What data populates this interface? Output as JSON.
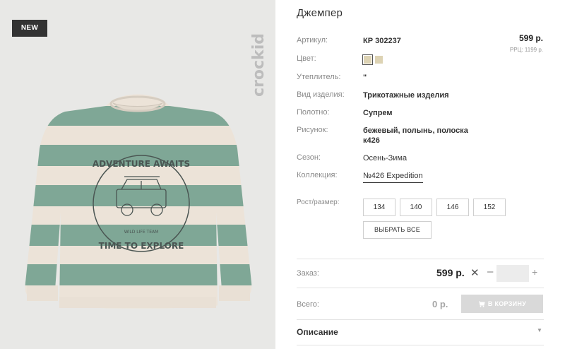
{
  "badge": "NEW",
  "brand": "crockid",
  "print": {
    "top_text": "ADVENTURE AWAITS",
    "bottom_text": "TIME TO EXPLORE",
    "small_text": "WILD LIFE TEAM"
  },
  "product": {
    "title": "Джемпер",
    "price": "599 р.",
    "rrp": "РРЦ: 1199 р."
  },
  "attributes": [
    {
      "label": "Артикул:",
      "value": "КР 302237"
    },
    {
      "label": "Цвет:",
      "value": ""
    },
    {
      "label": "Утеплитель:",
      "value": "\""
    },
    {
      "label": "Вид изделия:",
      "value": "Трикотажные изделия"
    },
    {
      "label": "Полотно:",
      "value": "Супрем"
    },
    {
      "label": "Рисунок:",
      "value": "бежевый, полынь, полоска",
      "value2": "к426"
    },
    {
      "label": "Сезон:",
      "value": "Осень-Зима"
    },
    {
      "label": "Коллекция:",
      "value": "№426 Expedition"
    }
  ],
  "colors": [
    "#ddd3b4",
    "#ddd3b4"
  ],
  "size": {
    "label": "Рост/размер:",
    "options": [
      "134",
      "140",
      "146",
      "152"
    ],
    "select_all": "ВЫБРАТЬ ВСЕ"
  },
  "order": {
    "label": "Заказ:",
    "price": "599 р.",
    "times": "✕",
    "minus": "–",
    "quantity": "",
    "plus": "+"
  },
  "total": {
    "label": "Всего:",
    "price": "0 р.",
    "cart_button": "В КОРЗИНУ"
  },
  "description": {
    "label": "Описание",
    "chevron": "▼"
  }
}
